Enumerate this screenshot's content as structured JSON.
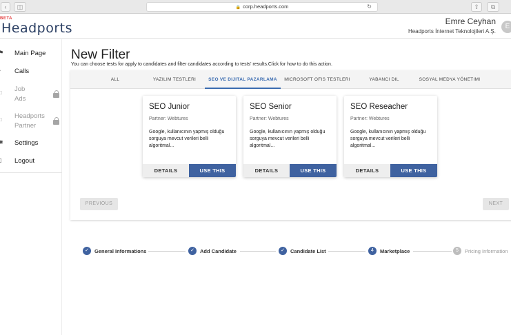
{
  "browser": {
    "url": "corp.headports.com"
  },
  "header": {
    "logo_badge": "BETA",
    "logo_text": "Headports",
    "user_name": "Emre Ceyhan",
    "company": "Headports İnternet Teknolojileri A.Ş.",
    "avatar_initial": "E"
  },
  "sidebar": {
    "items": [
      {
        "label": "Main Page",
        "icon": "home-icon",
        "locked": false
      },
      {
        "label": "Calls",
        "icon": "calls-icon",
        "locked": false
      },
      {
        "label": "Job\nAds",
        "icon": "job-ads-icon",
        "locked": true
      },
      {
        "label": "Headports\nPartner",
        "icon": "partner-icon",
        "locked": true
      },
      {
        "label": "Settings",
        "icon": "settings-icon",
        "locked": false
      },
      {
        "label": "Logout",
        "icon": "logout-icon",
        "locked": false
      }
    ]
  },
  "page": {
    "title": "New Filter",
    "description": "You can choose tests for apply to candidates and filter candidates according to tests' results.Click for how to do this action."
  },
  "tabs": [
    {
      "label": "ALL",
      "active": false
    },
    {
      "label": "YAZILIM TESTLERI",
      "active": false
    },
    {
      "label": "SEO VE DIJITAL PAZARLAMA",
      "active": true
    },
    {
      "label": "MICROSOFT OFIS TESTLERI",
      "active": false
    },
    {
      "label": "YABANCI DIL",
      "active": false
    },
    {
      "label": "SOSYAL MEDYA YÖNETIMI",
      "active": false
    }
  ],
  "cards": [
    {
      "title": "SEO Junior",
      "partner": "Partner: Webtures",
      "description": "Google, kullanıcının yapmış olduğu sorguya mevcut verileri belli algoritmal...",
      "details_label": "DETAILS",
      "use_label": "USE THIS"
    },
    {
      "title": "SEO Senior",
      "partner": "Partner: Webtures",
      "description": "Google, kullanıcının yapmış olduğu sorguya mevcut verileri belli algoritmal...",
      "details_label": "DETAILS",
      "use_label": "USE THIS"
    },
    {
      "title": "SEO Reseacher",
      "partner": "Partner: Webtures",
      "description": "Google, kullanıcının yapmış olduğu sorguya mevcut verileri belli algoritmal...",
      "details_label": "DETAILS",
      "use_label": "USE THIS"
    }
  ],
  "pagination": {
    "previous_label": "PREVIOUS",
    "next_label": "NEXT"
  },
  "stepper": {
    "steps": [
      {
        "label": "General Informations",
        "state": "done",
        "number": ""
      },
      {
        "label": "Add Candidate",
        "state": "done",
        "number": ""
      },
      {
        "label": "Candidate List",
        "state": "done",
        "number": ""
      },
      {
        "label": "Marketplace",
        "state": "active",
        "number": "4"
      },
      {
        "label": "Pricing Information",
        "state": "todo",
        "number": "5"
      }
    ]
  },
  "colors": {
    "primary": "#3f62a0",
    "tab_active": "#3a6bb0",
    "logo": "#2b3f63",
    "beta": "#e23b3b"
  }
}
